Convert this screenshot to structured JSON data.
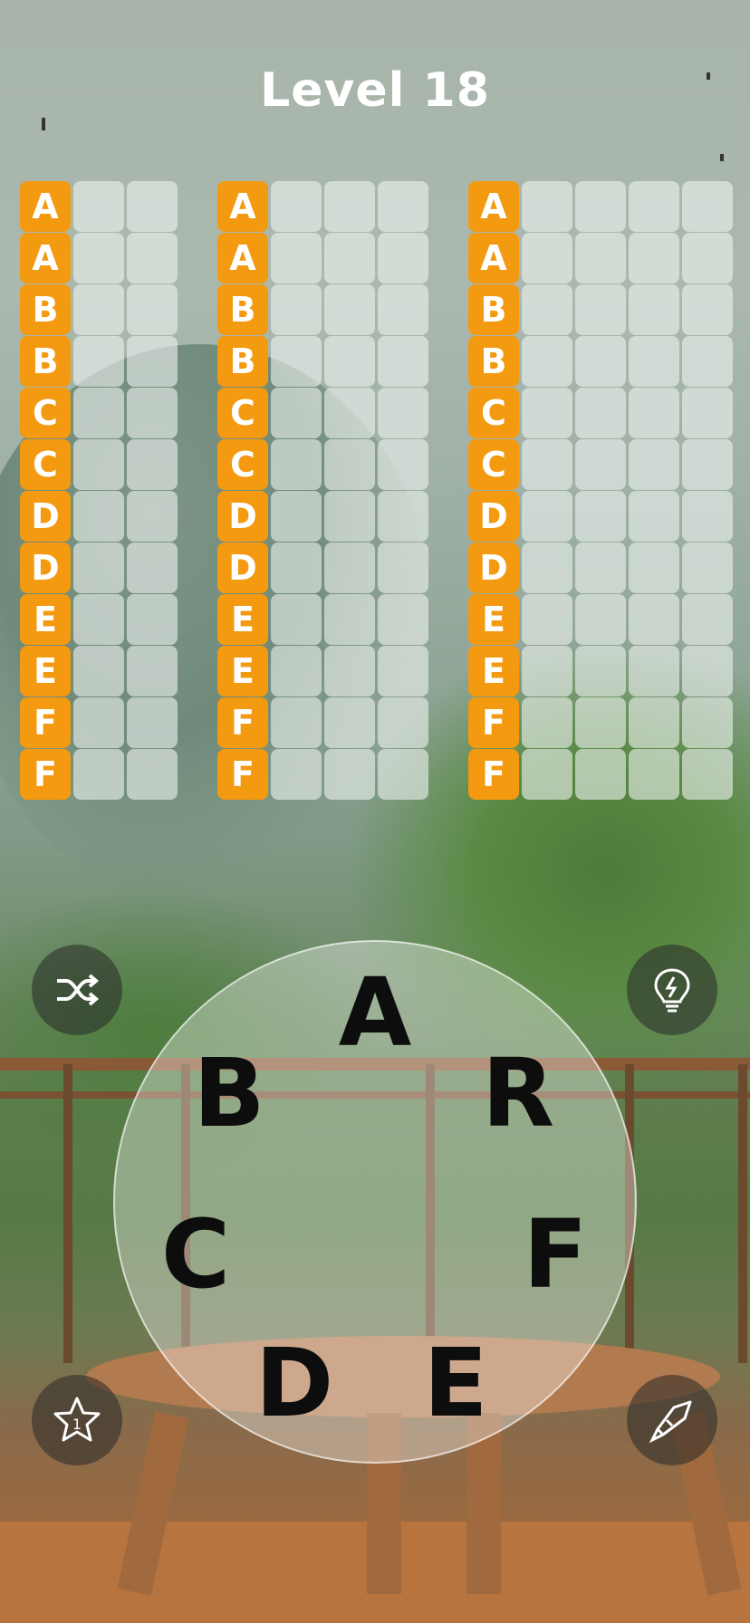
{
  "level_title": "Level 18",
  "letter_wheel": [
    "A",
    "R",
    "F",
    "E",
    "D",
    "C",
    "B"
  ],
  "word_columns": [
    {
      "word_length": 3,
      "hints": [
        "A",
        "A",
        "B",
        "B",
        "C",
        "C",
        "D",
        "D",
        "E",
        "E",
        "F",
        "F"
      ]
    },
    {
      "word_length": 4,
      "hints": [
        "A",
        "A",
        "B",
        "B",
        "C",
        "C",
        "D",
        "D",
        "E",
        "E",
        "F",
        "F"
      ]
    },
    {
      "word_length": 5,
      "hints": [
        "A",
        "A",
        "B",
        "B",
        "C",
        "C",
        "D",
        "D",
        "E",
        "E",
        "F",
        "F"
      ]
    }
  ],
  "buttons": {
    "shuffle_icon": "shuffle-icon",
    "hint_icon": "lightbulb-icon",
    "star_icon": "star-icon",
    "star_count": "1",
    "rocket_icon": "rocket-icon"
  },
  "colors": {
    "hint_tile": "#f39a11",
    "empty_tile": "#ebf0ee",
    "title": "#ffffff"
  }
}
